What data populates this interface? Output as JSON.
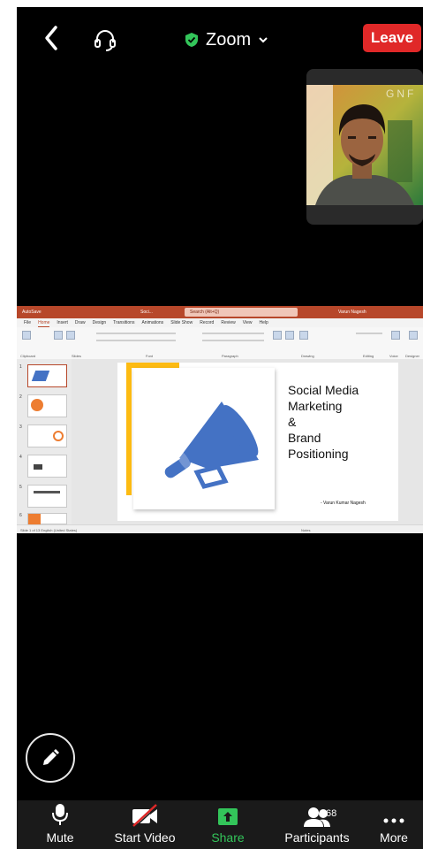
{
  "header": {
    "title": "Zoom",
    "leave_label": "Leave",
    "icons": [
      "back-arrow-icon",
      "headset-icon",
      "encryption-shield-icon",
      "chevron-down-icon"
    ]
  },
  "colors": {
    "leave": "#e02828",
    "share": "#33c55a",
    "ppt_brand": "#b7472a",
    "slide_accent": "#fdbb12",
    "megaphone": "#4472c4"
  },
  "thumbnail": {
    "watermark": "GNF"
  },
  "shared_screen": {
    "app_bar": {
      "autosave": "AutoSave",
      "doc_name": "Soci...",
      "search": "Search (Alt+Q)",
      "user": "Varun Nagesh"
    },
    "tabs": [
      "File",
      "Home",
      "Insert",
      "Draw",
      "Design",
      "Transitions",
      "Animations",
      "Slide Show",
      "Record",
      "Review",
      "View",
      "Help"
    ],
    "active_tab": "Home",
    "ribbon_groups": [
      "Clipboard",
      "Slides",
      "Font",
      "Paragraph",
      "Drawing",
      "Editing",
      "Voice",
      "Designer"
    ],
    "slide_numbers": [
      "1",
      "2",
      "3",
      "4",
      "5",
      "6"
    ],
    "slide": {
      "title_lines": [
        "Social Media",
        "Marketing",
        "&",
        "Brand",
        "Positioning"
      ],
      "author": "- Varun Kumar Nagesh"
    },
    "status": {
      "left": "Slide 1 of 13     English (United States)",
      "right": "Notes"
    }
  },
  "annotate": {
    "icon": "pencil-icon"
  },
  "toolbar": {
    "mute_label": "Mute",
    "video_label": "Start Video",
    "share_label": "Share",
    "participants_label": "Participants",
    "participants_count": "68",
    "more_label": "More"
  }
}
